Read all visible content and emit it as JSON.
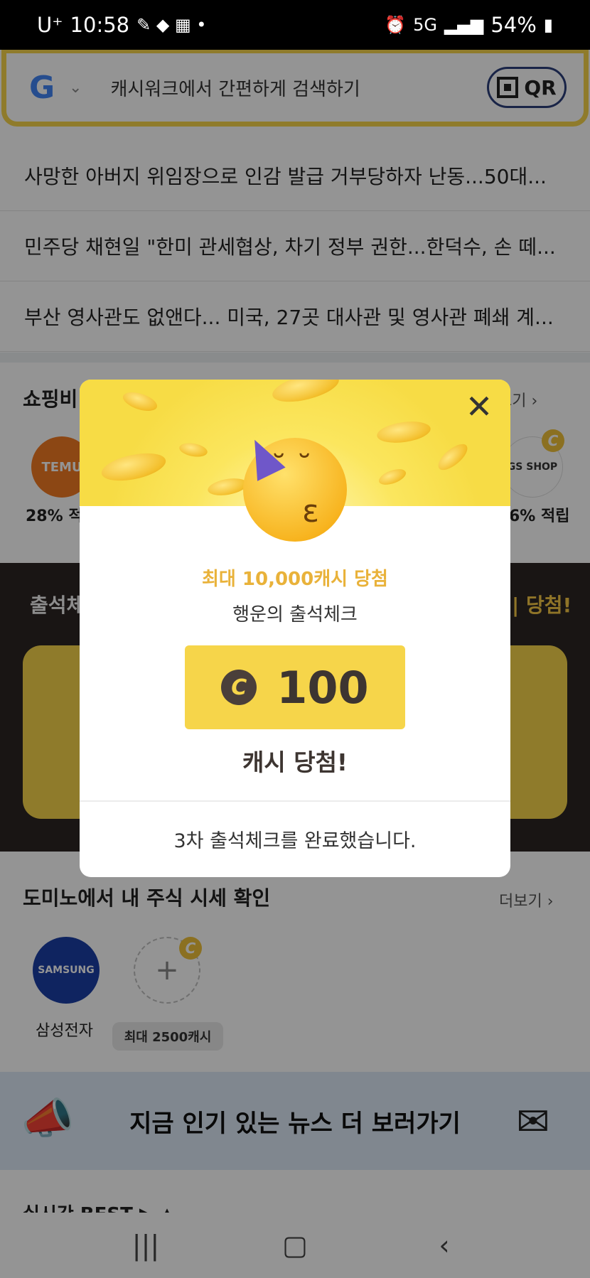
{
  "status_bar": {
    "carrier": "U⁺",
    "time": "10:58",
    "network": "5G",
    "battery": "54%"
  },
  "search": {
    "placeholder": "캐시워크에서 간편하게 검색하기",
    "qr_label": "QR"
  },
  "news": [
    "사망한 아버지 위임장으로 인감 발급 거부당하자 난동...50대...",
    "민주당 채현일 \"한미 관세협상, 차기 정부 권한...한덕수, 손 떼...",
    "부산 영사관도 없앤다... 미국, 27곳 대사관 및 영사관 폐쇄 계..."
  ],
  "shopping": {
    "title": "쇼핑비",
    "more": "보기 ›",
    "left_store": "TEMU",
    "left_rate": "28% 적",
    "right_store": "GS SHOP",
    "right_rate": "6% 적립"
  },
  "attendance_bg": {
    "title": "출석체",
    "right_text": "| 당첨!"
  },
  "domino": {
    "title": "도미노에서 내 주식 시세 확인",
    "more": "더보기 ›",
    "stock_logo": "SAMSUNG",
    "stock_name": "삼성전자",
    "add_tooltip": "최대 2500캐시"
  },
  "banner": {
    "text": "지금 인기 있는 뉴스 더 보러가기"
  },
  "bottom_peek": "실시간 BEST ▶ ▲",
  "modal": {
    "subtitle": "최대 10,000캐시 당첨",
    "title": "행운의 출석체크",
    "prize_amount": "100",
    "result": "캐시 당첨!",
    "footer": "3차 출석체크를 완료했습니다."
  },
  "colors": {
    "accent_yellow": "#f6d54a",
    "subtitle_gold": "#e9b23a",
    "dark_brown": "#3d3531"
  }
}
